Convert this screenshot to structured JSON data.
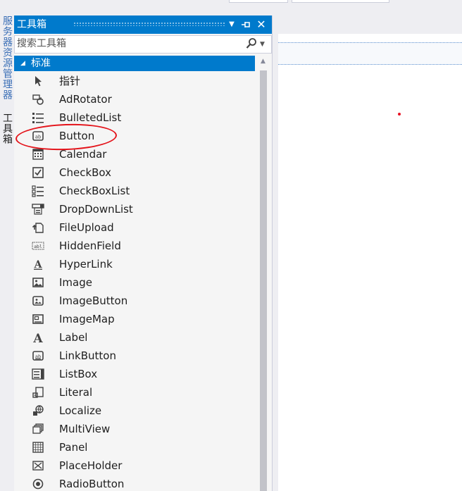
{
  "side_tabs": {
    "server_explorer": "服务器资源管理器",
    "toolbox": "工具箱"
  },
  "toolbox": {
    "title": "工具箱",
    "search_placeholder": "搜索工具箱",
    "category": "标准",
    "items": [
      {
        "label": "指针",
        "icon": "pointer-icon"
      },
      {
        "label": "AdRotator",
        "icon": "adrotator-icon"
      },
      {
        "label": "BulletedList",
        "icon": "bulletedlist-icon"
      },
      {
        "label": "Button",
        "icon": "button-icon"
      },
      {
        "label": "Calendar",
        "icon": "calendar-icon"
      },
      {
        "label": "CheckBox",
        "icon": "checkbox-icon"
      },
      {
        "label": "CheckBoxList",
        "icon": "checkboxlist-icon"
      },
      {
        "label": "DropDownList",
        "icon": "dropdownlist-icon"
      },
      {
        "label": "FileUpload",
        "icon": "fileupload-icon"
      },
      {
        "label": "HiddenField",
        "icon": "hiddenfield-icon"
      },
      {
        "label": "HyperLink",
        "icon": "hyperlink-icon"
      },
      {
        "label": "Image",
        "icon": "image-icon"
      },
      {
        "label": "ImageButton",
        "icon": "imagebutton-icon"
      },
      {
        "label": "ImageMap",
        "icon": "imagemap-icon"
      },
      {
        "label": "Label",
        "icon": "label-icon"
      },
      {
        "label": "LinkButton",
        "icon": "linkbutton-icon"
      },
      {
        "label": "ListBox",
        "icon": "listbox-icon"
      },
      {
        "label": "Literal",
        "icon": "literal-icon"
      },
      {
        "label": "Localize",
        "icon": "localize-icon"
      },
      {
        "label": "MultiView",
        "icon": "multiview-icon"
      },
      {
        "label": "Panel",
        "icon": "panel-icon"
      },
      {
        "label": "PlaceHolder",
        "icon": "placeholder-icon"
      },
      {
        "label": "RadioButton",
        "icon": "radiobutton-icon"
      }
    ]
  },
  "colors": {
    "accent": "#007acc",
    "annotation": "#e4131a",
    "icon": "#424242"
  }
}
